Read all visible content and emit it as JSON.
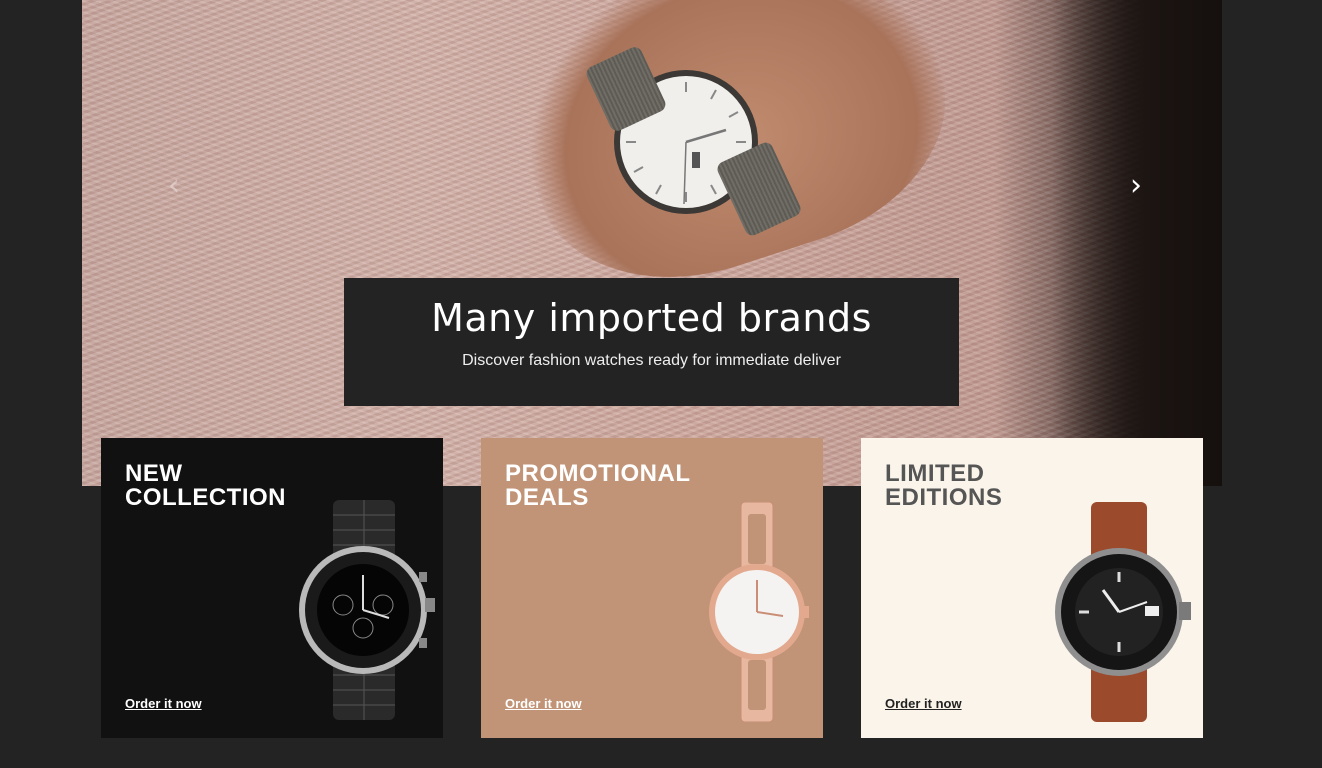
{
  "hero": {
    "title": "Many imported brands",
    "subtitle": "Discover fashion watches ready for immediate deliver",
    "prev_arrow": "‹",
    "next_arrow": "›"
  },
  "cards": [
    {
      "heading": "NEW\nCOLLECTION",
      "cta": "Order it now",
      "bg": "#111111",
      "text_color": "#ffffff"
    },
    {
      "heading": "PROMOTIONAL\nDEALS",
      "cta": "Order it now",
      "bg": "#c19477",
      "text_color": "#ffffff"
    },
    {
      "heading": "LIMITED\nEDITIONS",
      "cta": "Order it now",
      "bg": "#fbf4ea",
      "text_color": "#555555"
    }
  ],
  "colors": {
    "page_bg": "#232323",
    "caption_bg": "#232323"
  },
  "icons": {
    "prev": "chevron-left-icon",
    "next": "chevron-right-icon"
  }
}
